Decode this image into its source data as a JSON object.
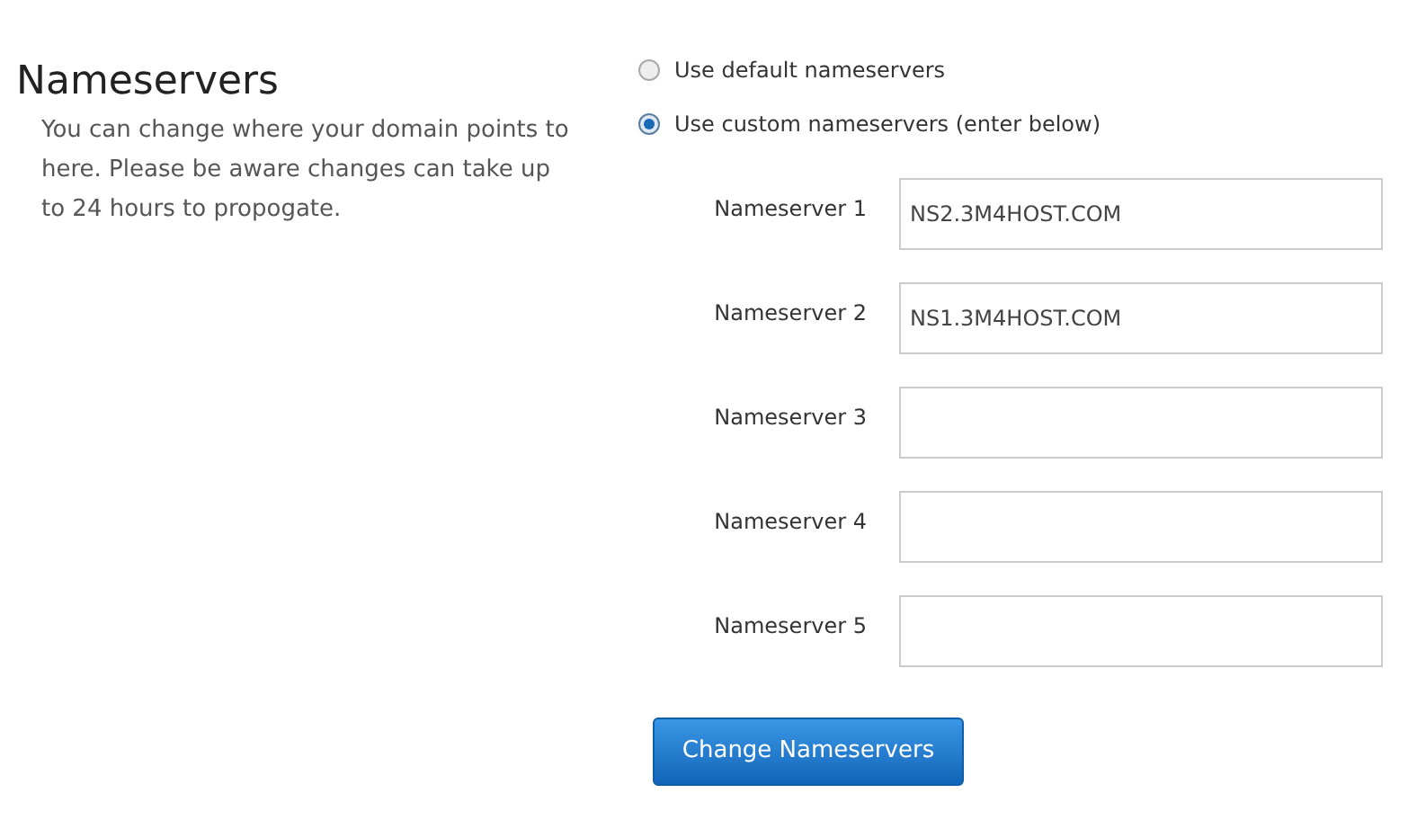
{
  "heading": "Nameservers",
  "description": "You can change where your domain points to here. Please be aware changes can take up to 24 hours to propogate.",
  "options": [
    {
      "label": "Use default nameservers",
      "selected": false
    },
    {
      "label": "Use custom nameservers (enter below)",
      "selected": true
    }
  ],
  "fields": [
    {
      "label": "Nameserver 1",
      "value": "NS2.3M4HOST.COM"
    },
    {
      "label": "Nameserver 2",
      "value": "NS1.3M4HOST.COM"
    },
    {
      "label": "Nameserver 3"
    },
    {
      "label": "Nameserver 4"
    },
    {
      "label": "Nameserver 5"
    }
  ],
  "button": "Change Nameservers"
}
